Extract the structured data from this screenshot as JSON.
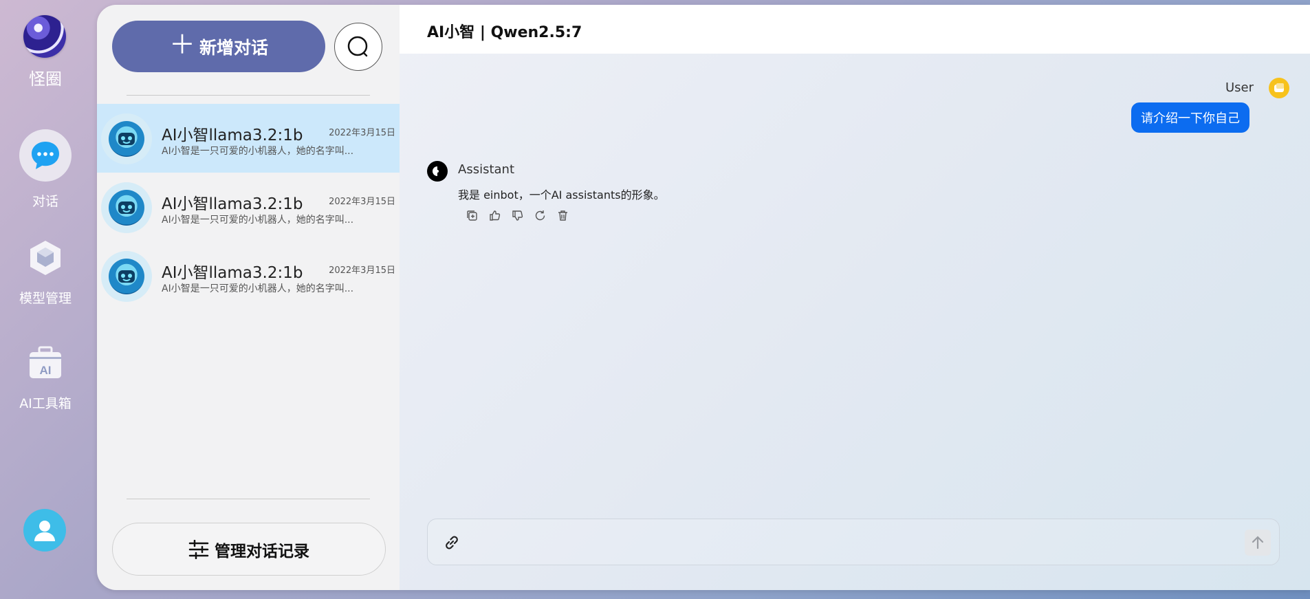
{
  "brand": {
    "name": "怪圈",
    "logo_icon": "planet-logo-icon"
  },
  "nav": [
    {
      "label": "对话",
      "icon": "chat-bubble-icon",
      "active": true
    },
    {
      "label": "模型管理",
      "icon": "cube-icon"
    },
    {
      "label": "AI工具箱",
      "icon": "toolbox-ai-icon"
    }
  ],
  "profile": {
    "icon": "user-avatar-icon"
  },
  "sidebar": {
    "new_chat_label": "新增对话",
    "search_icon": "search-icon",
    "manage_label": "管理对话记录",
    "conversations": [
      {
        "title": "AI小智llama3.2:1b",
        "date": "2022年3月15日",
        "preview": "AI小智是一只可爱的小机器人，她的名字叫..."
      },
      {
        "title": "AI小智llama3.2:1b",
        "date": "2022年3月15日",
        "preview": "AI小智是一只可爱的小机器人，她的名字叫..."
      },
      {
        "title": "AI小智llama3.2:1b",
        "date": "2022年3月15日",
        "preview": "AI小智是一只可爱的小机器人，她的名字叫..."
      }
    ]
  },
  "chat": {
    "title": "AI小智 | Qwen2.5:7",
    "user_name": "User",
    "user_message": "请介绍一下你自己",
    "assistant_name": "Assistant",
    "assistant_message": "我是 einbot，一个AI assistants的形象。",
    "actions": [
      "copy-icon",
      "thumbs-up-icon",
      "thumbs-down-icon",
      "regenerate-icon",
      "delete-icon"
    ]
  },
  "colors": {
    "primary": "#5f6bab",
    "bubble": "#0c6cf0",
    "active_row": "#cce8fb"
  }
}
